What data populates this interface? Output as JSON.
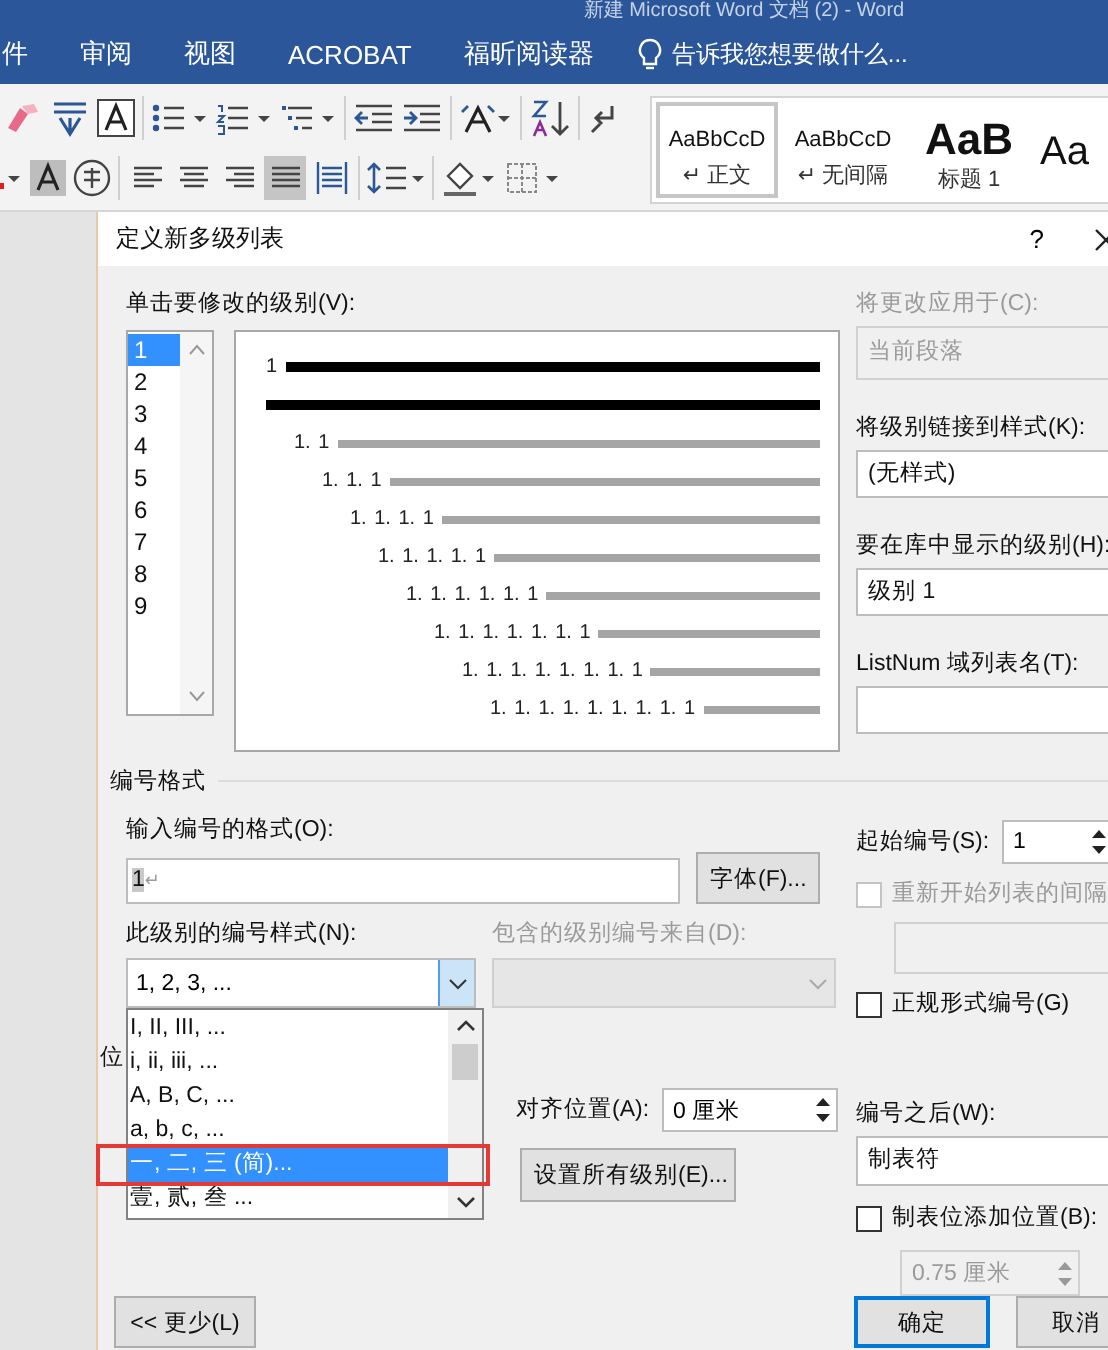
{
  "window": {
    "title": "新建 Microsoft Word 文档 (2) - Word"
  },
  "ribbon_tabs": [
    {
      "label": "件"
    },
    {
      "label": "审阅"
    },
    {
      "label": "视图"
    },
    {
      "label": "ACROBAT"
    },
    {
      "label": "福昕阅读器"
    }
  ],
  "tell_me": {
    "placeholder": "告诉我您想要做什么..."
  },
  "ribbon": {
    "paragraph_align": [
      {
        "selected": false
      },
      {
        "selected": false
      },
      {
        "selected": false
      },
      {
        "selected": true
      },
      {
        "selected": false
      }
    ],
    "styles": [
      {
        "kind": "normal",
        "sample": "AaBbCcD",
        "name": "↵ 正文",
        "selected": true
      },
      {
        "kind": "normal",
        "sample": "AaBbCcD",
        "name": "↵ 无间隔",
        "selected": false
      },
      {
        "kind": "heading",
        "sample": "AaB",
        "name": "标题 1",
        "selected": false
      },
      {
        "kind": "heading2",
        "sample": "Aa",
        "selected": false
      }
    ]
  },
  "dialog": {
    "title": "定义新多级列表",
    "help": "?",
    "level_label": "单击要修改的级别(V):",
    "levels": [
      {
        "label": "1",
        "selected": true
      },
      {
        "label": "2",
        "selected": false
      },
      {
        "label": "3",
        "selected": false
      },
      {
        "label": "4",
        "selected": false
      },
      {
        "label": "5",
        "selected": false
      },
      {
        "label": "6",
        "selected": false
      },
      {
        "label": "7",
        "selected": false
      },
      {
        "label": "8",
        "selected": false
      },
      {
        "label": "9",
        "selected": false
      }
    ],
    "preview": {
      "lines": [
        {
          "label": "1",
          "selected": true
        },
        {
          "selected": true
        },
        {
          "label": "1. 1",
          "selected": false
        },
        {
          "label": "1. 1. 1",
          "selected": false
        },
        {
          "label": "1. 1. 1. 1",
          "selected": false
        },
        {
          "label": "1. 1. 1. 1. 1",
          "selected": false
        },
        {
          "label": "1. 1. 1. 1. 1. 1",
          "selected": false
        },
        {
          "label": "1. 1. 1. 1. 1. 1. 1",
          "selected": false
        },
        {
          "label": "1. 1. 1. 1. 1. 1. 1. 1",
          "selected": false
        },
        {
          "label": "1. 1. 1. 1. 1. 1. 1. 1. 1",
          "selected": false
        }
      ]
    },
    "apply_to": {
      "label": "将更改应用于(C):",
      "value": "当前段落",
      "disabled": true
    },
    "link_style": {
      "label": "将级别链接到样式(K):",
      "value": "(无样式)",
      "disabled": false
    },
    "gallery_level": {
      "label": "要在库中显示的级别(H):",
      "value": "级别 1",
      "disabled": false
    },
    "listnum": {
      "label": "ListNum 域列表名(T):",
      "disabled": false
    },
    "number_format_section": "编号格式",
    "format_input": {
      "label": "输入编号的格式(O):",
      "value": "1",
      "mark": "↵"
    },
    "font_button": "字体(F)...",
    "start_at": {
      "label": "起始编号(S):",
      "value": "1"
    },
    "restart": {
      "label": "重新开始列表的间隔",
      "checked": false,
      "disabled": true
    },
    "number_style": {
      "label": "此级别的编号样式(N):",
      "value": "1, 2, 3, ...",
      "expanded": true,
      "options": [
        {
          "label": "I, II, III, ...",
          "selected": false,
          "highlighted": false
        },
        {
          "label": "i, ii, iii, ...",
          "selected": false,
          "highlighted": false
        },
        {
          "label": "A, B, C, ...",
          "selected": false,
          "highlighted": false
        },
        {
          "label": "a, b, c, ...",
          "selected": false,
          "highlighted": false
        },
        {
          "label": "一, 二, 三 (简)...",
          "selected": true,
          "highlighted": true
        },
        {
          "label": "壹, 贰, 叁 ...",
          "selected": false,
          "highlighted": false
        }
      ]
    },
    "include_from": {
      "label": "包含的级别编号来自(D):",
      "disabled": true
    },
    "legal": {
      "label": "正规形式编号(G)",
      "checked": false,
      "disabled": false
    },
    "position_section": "位",
    "align_at": {
      "label": "对齐位置(A):",
      "value": "0 厘米"
    },
    "set_all_button": "设置所有级别(E)...",
    "follow": {
      "label": "编号之后(W):",
      "value": "制表符"
    },
    "tab_stop": {
      "label": "制表位添加位置(B):",
      "checked": false,
      "disabled": false,
      "value": "0.75 厘米",
      "value_disabled": true
    },
    "buttons": [
      {
        "label": "<< 更少(L)",
        "default": false
      },
      {
        "label": "确定",
        "default": true
      },
      {
        "label": "取消",
        "default": false
      }
    ]
  }
}
